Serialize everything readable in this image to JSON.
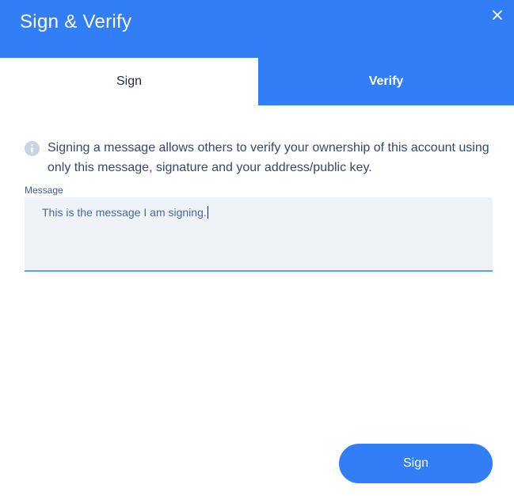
{
  "dialog": {
    "title": "Sign & Verify",
    "close_icon": "close-icon"
  },
  "tabs": [
    {
      "label": "Sign",
      "active": true
    },
    {
      "label": "Verify",
      "active": false
    }
  ],
  "info": {
    "icon": "info-icon",
    "text": "Signing a message allows others to verify your ownership of this account using only this message, signature and your address/public key."
  },
  "message": {
    "label": "Message",
    "value": "This is the message I am signing."
  },
  "actions": {
    "sign_label": "Sign"
  },
  "colors": {
    "brand": "#317ef6",
    "field_bg": "#eff3f8",
    "field_underline": "#5f9ff5"
  }
}
